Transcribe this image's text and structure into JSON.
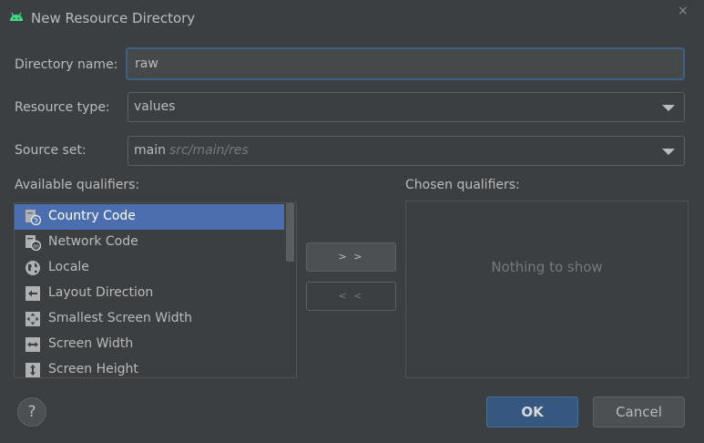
{
  "window": {
    "title": "New Resource Directory",
    "close_glyph": "×"
  },
  "form": {
    "directory_name_label": "Directory name:",
    "directory_name_value": "raw",
    "resource_type_label": "Resource type:",
    "resource_type_value": "values",
    "source_set_label": "Source set:",
    "source_set_value": "main",
    "source_set_hint": "src/main/res"
  },
  "qualifiers": {
    "available_label": "Available qualifiers:",
    "chosen_label": "Chosen qualifiers:",
    "empty_text": "Nothing to show",
    "add_label": "> >",
    "remove_label": "< <",
    "items": [
      {
        "label": "Country Code",
        "icon": "country-code-icon",
        "selected": true
      },
      {
        "label": "Network Code",
        "icon": "network-code-icon",
        "selected": false
      },
      {
        "label": "Locale",
        "icon": "globe-icon",
        "selected": false
      },
      {
        "label": "Layout Direction",
        "icon": "layout-direction-icon",
        "selected": false
      },
      {
        "label": "Smallest Screen Width",
        "icon": "smallest-width-icon",
        "selected": false
      },
      {
        "label": "Screen Width",
        "icon": "screen-width-icon",
        "selected": false
      },
      {
        "label": "Screen Height",
        "icon": "screen-height-icon",
        "selected": false
      }
    ]
  },
  "footer": {
    "help_label": "?",
    "ok_label": "OK",
    "cancel_label": "Cancel"
  },
  "colors": {
    "background": "#3c3f41",
    "selection": "#4b6eaf",
    "focus_border": "#3d6185",
    "android_green": "#3ddc84",
    "default_button": "#365880"
  }
}
